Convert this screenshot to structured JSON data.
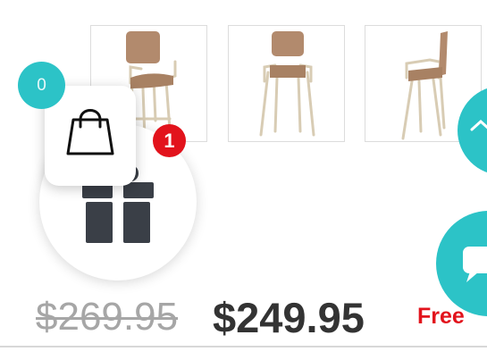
{
  "product": {
    "thumbnails": [
      {
        "name": "chair-angle-view"
      },
      {
        "name": "chair-front-view"
      },
      {
        "name": "chair-side-view"
      }
    ],
    "price_old": "$269.95",
    "price_new": "$249.95",
    "shipping_label": "Free"
  },
  "cart": {
    "count": "0",
    "icon": "shopping-bag-icon"
  },
  "gift": {
    "badge_count": "1",
    "icon": "gift-icon"
  },
  "floating_buttons": {
    "scroll_top_icon": "chevron-up-icon",
    "chat_icon": "chat-icon"
  },
  "colors": {
    "accent": "#2cc3c7",
    "badge_red": "#e2131c",
    "price_dark": "#333333",
    "price_muted": "#a6a6a6"
  }
}
